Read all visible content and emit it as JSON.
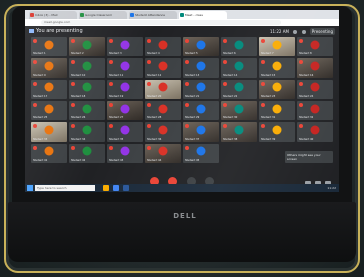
{
  "browser": {
    "tabs": [
      {
        "label": "Inbox (3) - Mail",
        "color": "#d93025"
      },
      {
        "label": "Google Classroom",
        "color": "#1e8e3e"
      },
      {
        "label": "Student Attendance",
        "color": "#1a73e8"
      },
      {
        "label": "Meet - class",
        "color": "#00897b",
        "active": true
      }
    ],
    "url": "meet.google.com"
  },
  "meet": {
    "presenting_text": "You are presenting",
    "clock": "11:22 AM",
    "presenter_label": "Presenting",
    "participant_names": [
      "Student 1",
      "Student 2",
      "Student 3",
      "Student 4",
      "Student 5",
      "Student 6",
      "Student 7",
      "Student 8",
      "Student 9",
      "Student 10",
      "Student 11",
      "Student 12",
      "Student 13",
      "Student 14",
      "Student 15",
      "Student 16",
      "Student 17",
      "Student 18",
      "Student 19",
      "Student 20",
      "Student 21",
      "Student 22",
      "Student 23",
      "Student 24",
      "Student 25",
      "Student 26",
      "Student 27",
      "Student 28",
      "Student 29",
      "Student 30",
      "Student 31",
      "Student 32",
      "Student 33",
      "Student 34",
      "Student 35",
      "Student 36",
      "Student 37",
      "Student 38",
      "Student 39",
      "Student 40",
      "Student 41",
      "Student 42",
      "Student 43",
      "Student 44",
      "Student 45"
    ],
    "avatar_colors": [
      "#e8710a",
      "#1e8e3e",
      "#9334e6",
      "#d93025",
      "#1a73e8",
      "#00897b",
      "#f9ab00",
      "#c5221f"
    ],
    "side_panel_text": "Others might see your screen"
  },
  "taskbar": {
    "search_text": "Type here to search",
    "time": "11:22"
  },
  "brand": "DELL"
}
